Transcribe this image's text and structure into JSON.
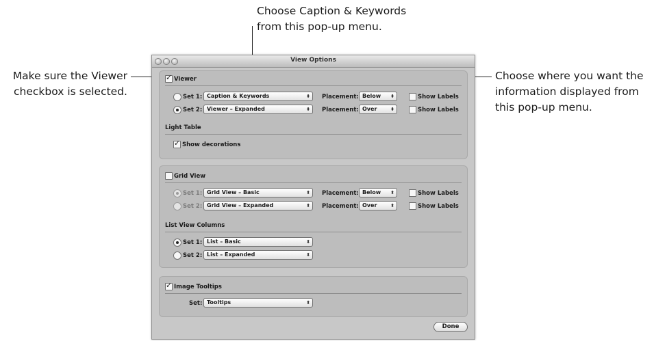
{
  "callouts": {
    "top": [
      "Choose Caption & Keywords",
      "from this pop-up menu."
    ],
    "left": [
      "Make sure the Viewer",
      "checkbox is selected."
    ],
    "right": [
      "Choose where you want the",
      "information displayed from",
      "this pop-up menu."
    ]
  },
  "window": {
    "title": "View Options"
  },
  "viewer": {
    "label": "Viewer",
    "checked": true,
    "rows": [
      {
        "set": "Set 1:",
        "popup": "Caption & Keywords",
        "placement_label": "Placement:",
        "placement": "Below",
        "show_labels": "Show Labels",
        "selected": false
      },
      {
        "set": "Set 2:",
        "popup": "Viewer – Expanded",
        "placement_label": "Placement:",
        "placement": "Over",
        "show_labels": "Show Labels",
        "selected": true
      }
    ]
  },
  "light_table": {
    "heading": "Light Table",
    "decorations": "Show decorations",
    "checked": true
  },
  "grid_view": {
    "label": "Grid View",
    "checked": false,
    "rows": [
      {
        "set": "Set 1:",
        "popup": "Grid View – Basic",
        "placement_label": "Placement:",
        "placement": "Below",
        "show_labels": "Show Labels",
        "selected": true
      },
      {
        "set": "Set 2:",
        "popup": "Grid View – Expanded",
        "placement_label": "Placement:",
        "placement": "Over",
        "show_labels": "Show Labels",
        "selected": false
      }
    ]
  },
  "list_view": {
    "heading": "List View Columns",
    "rows": [
      {
        "set": "Set 1:",
        "popup": "List – Basic",
        "selected": true
      },
      {
        "set": "Set 2:",
        "popup": "List – Expanded",
        "selected": false
      }
    ]
  },
  "tooltips": {
    "label": "Image Tooltips",
    "checked": true,
    "set_label": "Set:",
    "popup": "Tooltips"
  },
  "done_label": "Done"
}
